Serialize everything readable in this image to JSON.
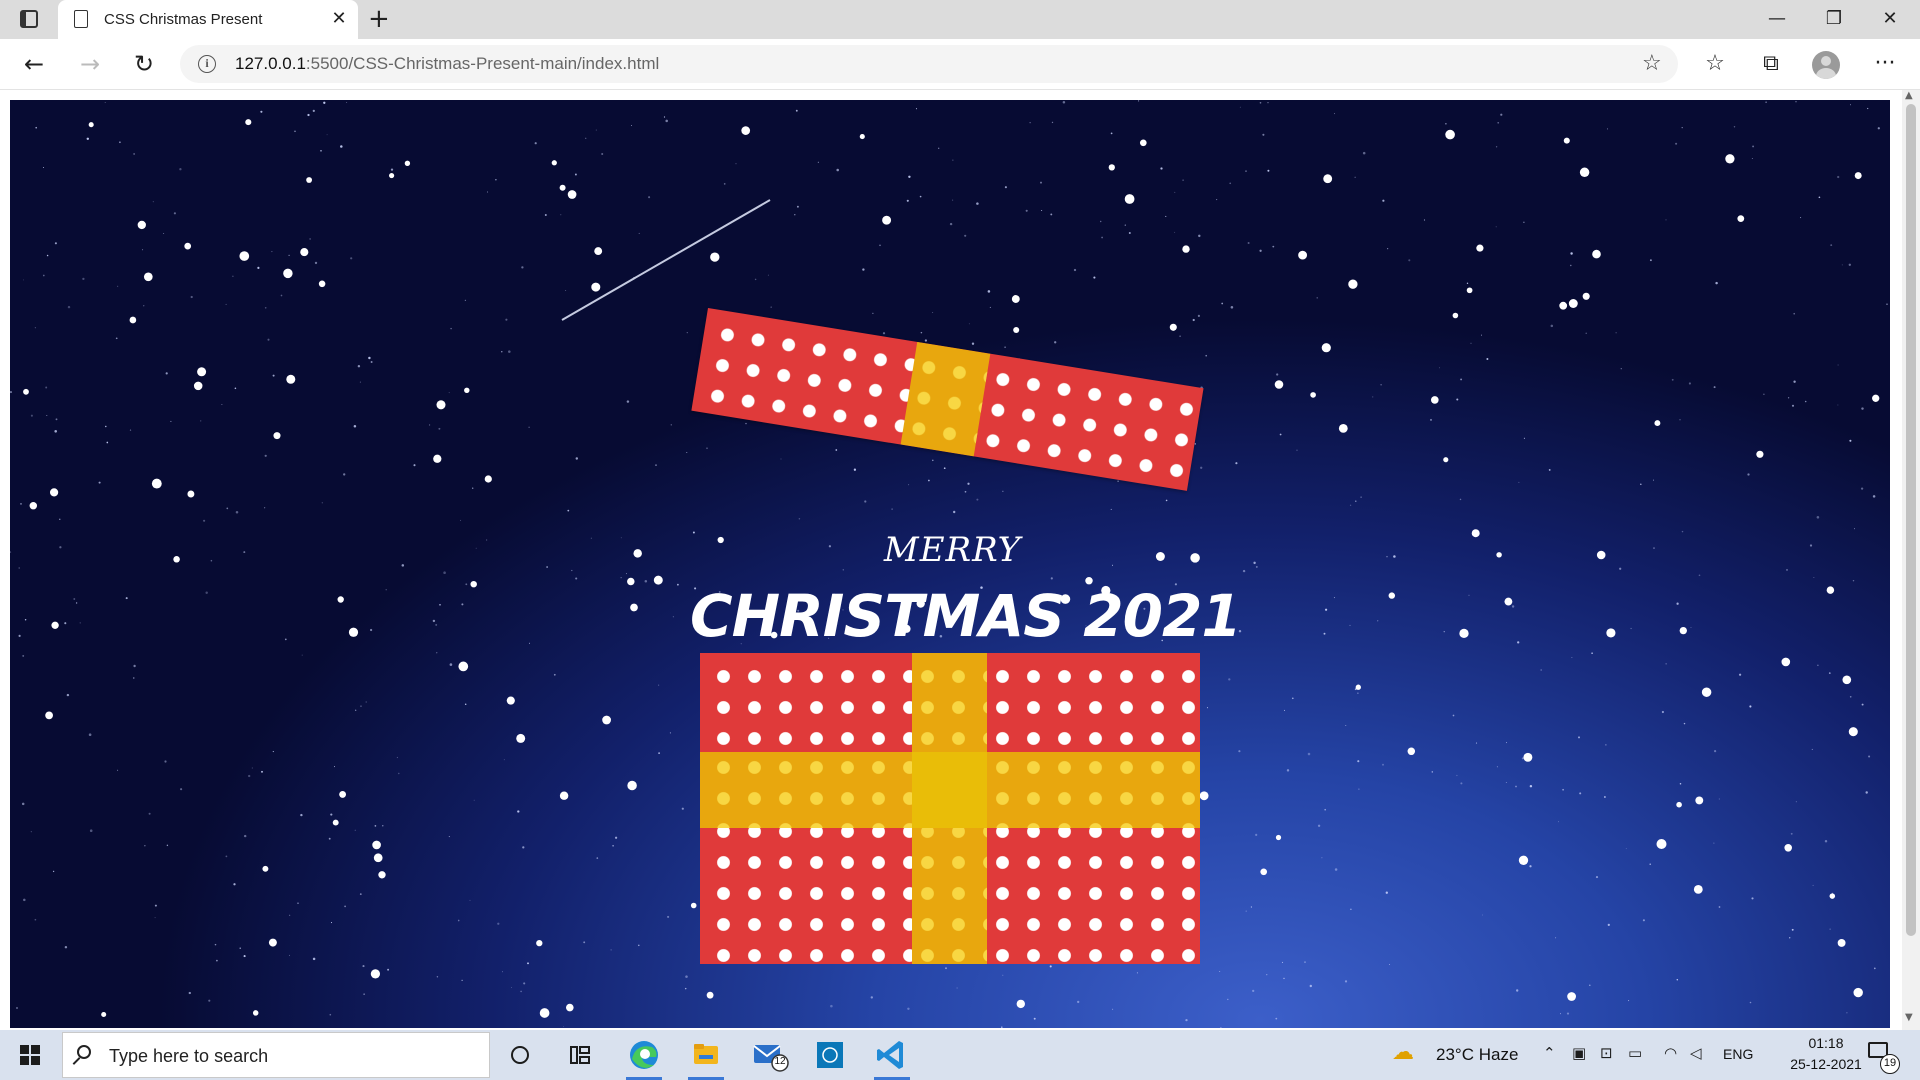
{
  "browser": {
    "tab_title": "CSS Christmas Present",
    "url_host": "127.0.0.1",
    "url_path": ":5500/CSS-Christmas-Present-main/index.html",
    "icons": [
      "window-menu-icon",
      "document-icon",
      "close-icon",
      "plus-icon",
      "back-icon",
      "forward-icon",
      "reload-icon",
      "info-icon",
      "add-favorite-icon",
      "favorites-icon",
      "collections-icon",
      "profile-avatar",
      "more-icon"
    ]
  },
  "page": {
    "greeting_line1": "MERRY",
    "greeting_line2": "CHRISTMAS 2021",
    "colors": {
      "gift_red": "#e03a3a",
      "ribbon_gold": "#e8a70e",
      "sky": "#12206a"
    }
  },
  "taskbar": {
    "search_placeholder": "Type here to search",
    "mail_badge": "12",
    "weather": "23°C  Haze",
    "language": "ENG",
    "time": "01:18",
    "date": "25-12-2021",
    "notification_count": "19"
  }
}
